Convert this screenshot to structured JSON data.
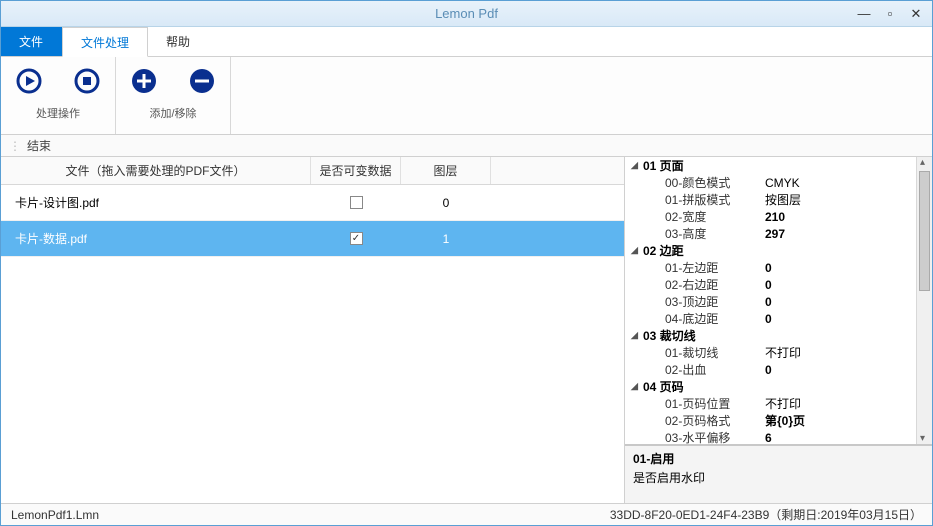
{
  "title": "Lemon Pdf",
  "menu": {
    "file": "文件",
    "fileproc": "文件处理",
    "help": "帮助"
  },
  "ribbon": {
    "group1": "处理操作",
    "group2": "添加/移除"
  },
  "subbar": "结束",
  "table": {
    "headers": {
      "file": "文件（拖入需要处理的PDF文件）",
      "vardata": "是否可变数据",
      "layers": "图层"
    },
    "rows": [
      {
        "file": "卡片-设计图.pdf",
        "checked": false,
        "layers": "0",
        "selected": false
      },
      {
        "file": "卡片-数据.pdf",
        "checked": true,
        "layers": "1",
        "selected": true
      }
    ]
  },
  "props": [
    {
      "cat": "01 页面",
      "items": [
        {
          "k": "00-颜色模式",
          "v": "CMYK"
        },
        {
          "k": "01-拼版模式",
          "v": "按图层"
        },
        {
          "k": "02-宽度",
          "v": "210",
          "bold": true
        },
        {
          "k": "03-高度",
          "v": "297",
          "bold": true
        }
      ]
    },
    {
      "cat": "02 边距",
      "items": [
        {
          "k": "01-左边距",
          "v": "0",
          "bold": true
        },
        {
          "k": "02-右边距",
          "v": "0",
          "bold": true
        },
        {
          "k": "03-顶边距",
          "v": "0",
          "bold": true
        },
        {
          "k": "04-底边距",
          "v": "0",
          "bold": true
        }
      ]
    },
    {
      "cat": "03 裁切线",
      "items": [
        {
          "k": "01-裁切线",
          "v": "不打印"
        },
        {
          "k": "02-出血",
          "v": "0",
          "bold": true
        }
      ]
    },
    {
      "cat": "04 页码",
      "items": [
        {
          "k": "01-页码位置",
          "v": "不打印"
        },
        {
          "k": "02-页码格式",
          "v": "第{0}页",
          "bold": true
        },
        {
          "k": "03-水平偏移",
          "v": "6",
          "bold": true
        }
      ]
    }
  ],
  "desc": {
    "title": "01-启用",
    "text": "是否启用水印"
  },
  "status": {
    "left": "LemonPdf1.Lmn",
    "right": "33DD-8F20-0ED1-24F4-23B9（剩期日:2019年03月15日）"
  }
}
